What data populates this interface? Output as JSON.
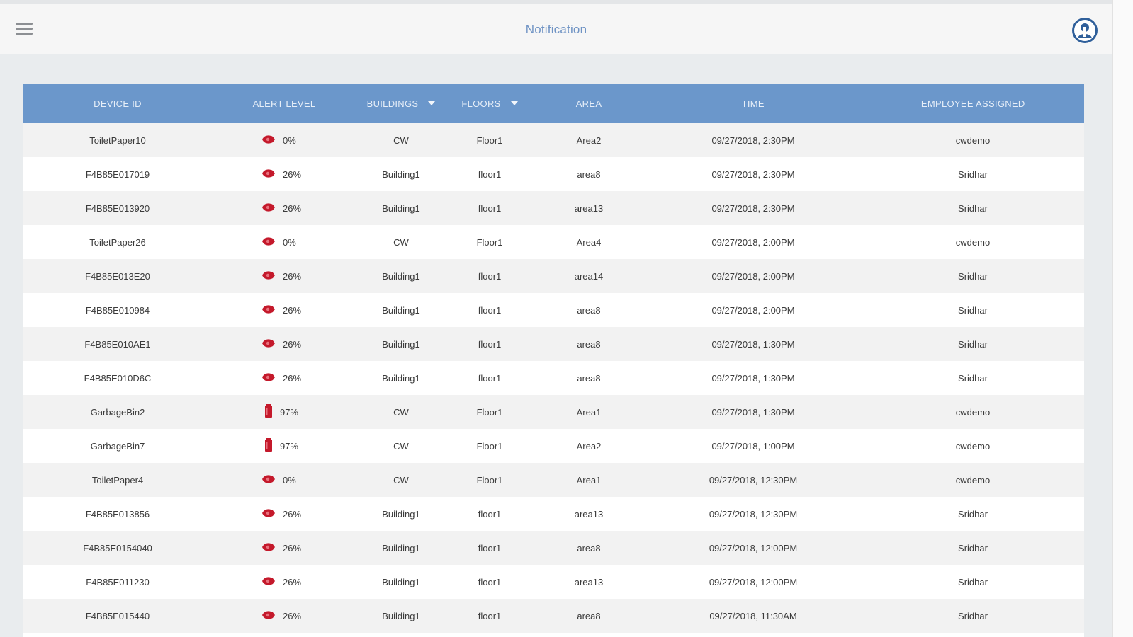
{
  "header": {
    "title": "Notification"
  },
  "table": {
    "columns": {
      "device_id": "DEVICE ID",
      "alert_level": "ALERT LEVEL",
      "buildings": "BUILDINGS",
      "floors": "FLOORS",
      "area": "AREA",
      "time": "TIME",
      "employee": "EMPLOYEE ASSIGNED"
    },
    "rows": [
      {
        "device": "ToiletPaper10",
        "icon": "toilet-paper-icon",
        "level": "0%",
        "building": "CW",
        "floor": "Floor1",
        "area": "Area2",
        "time": "09/27/2018, 2:30PM",
        "employee": "cwdemo"
      },
      {
        "device": "F4B85E017019",
        "icon": "toilet-paper-icon",
        "level": "26%",
        "building": "Building1",
        "floor": "floor1",
        "area": "area8",
        "time": "09/27/2018, 2:30PM",
        "employee": "Sridhar"
      },
      {
        "device": "F4B85E013920",
        "icon": "toilet-paper-icon",
        "level": "26%",
        "building": "Building1",
        "floor": "floor1",
        "area": "area13",
        "time": "09/27/2018, 2:30PM",
        "employee": "Sridhar"
      },
      {
        "device": "ToiletPaper26",
        "icon": "toilet-paper-icon",
        "level": "0%",
        "building": "CW",
        "floor": "Floor1",
        "area": "Area4",
        "time": "09/27/2018, 2:00PM",
        "employee": "cwdemo"
      },
      {
        "device": "F4B85E013E20",
        "icon": "toilet-paper-icon",
        "level": "26%",
        "building": "Building1",
        "floor": "floor1",
        "area": "area14",
        "time": "09/27/2018, 2:00PM",
        "employee": "Sridhar"
      },
      {
        "device": "F4B85E010984",
        "icon": "toilet-paper-icon",
        "level": "26%",
        "building": "Building1",
        "floor": "floor1",
        "area": "area8",
        "time": "09/27/2018, 2:00PM",
        "employee": "Sridhar"
      },
      {
        "device": "F4B85E010AE1",
        "icon": "toilet-paper-icon",
        "level": "26%",
        "building": "Building1",
        "floor": "floor1",
        "area": "area8",
        "time": "09/27/2018, 1:30PM",
        "employee": "Sridhar"
      },
      {
        "device": "F4B85E010D6C",
        "icon": "toilet-paper-icon",
        "level": "26%",
        "building": "Building1",
        "floor": "floor1",
        "area": "area8",
        "time": "09/27/2018, 1:30PM",
        "employee": "Sridhar"
      },
      {
        "device": "GarbageBin2",
        "icon": "garbage-bin-icon",
        "level": "97%",
        "building": "CW",
        "floor": "Floor1",
        "area": "Area1",
        "time": "09/27/2018, 1:30PM",
        "employee": "cwdemo"
      },
      {
        "device": "GarbageBin7",
        "icon": "garbage-bin-icon",
        "level": "97%",
        "building": "CW",
        "floor": "Floor1",
        "area": "Area2",
        "time": "09/27/2018, 1:00PM",
        "employee": "cwdemo"
      },
      {
        "device": "ToiletPaper4",
        "icon": "toilet-paper-icon",
        "level": "0%",
        "building": "CW",
        "floor": "Floor1",
        "area": "Area1",
        "time": "09/27/2018, 12:30PM",
        "employee": "cwdemo"
      },
      {
        "device": "F4B85E013856",
        "icon": "toilet-paper-icon",
        "level": "26%",
        "building": "Building1",
        "floor": "floor1",
        "area": "area13",
        "time": "09/27/2018, 12:30PM",
        "employee": "Sridhar"
      },
      {
        "device": "F4B85E0154040",
        "icon": "toilet-paper-icon",
        "level": "26%",
        "building": "Building1",
        "floor": "floor1",
        "area": "area8",
        "time": "09/27/2018, 12:00PM",
        "employee": "Sridhar"
      },
      {
        "device": "F4B85E011230",
        "icon": "toilet-paper-icon",
        "level": "26%",
        "building": "Building1",
        "floor": "floor1",
        "area": "area13",
        "time": "09/27/2018, 12:00PM",
        "employee": "Sridhar"
      },
      {
        "device": "F4B85E015440",
        "icon": "toilet-paper-icon",
        "level": "26%",
        "building": "Building1",
        "floor": "floor1",
        "area": "area8",
        "time": "09/27/2018, 11:30AM",
        "employee": "Sridhar"
      }
    ]
  },
  "colors": {
    "accent": "#6b97cb",
    "alert": "#c4192b",
    "title": "#6f93c4"
  }
}
